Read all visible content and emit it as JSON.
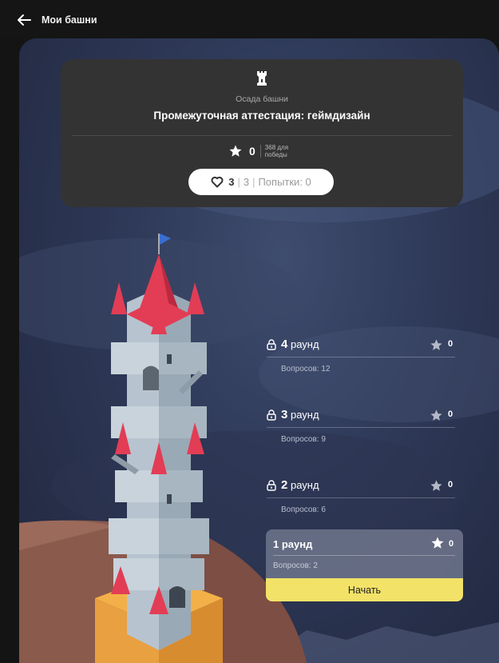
{
  "header": {
    "back_label": "Мои башни"
  },
  "tower_card": {
    "subtitle": "Осада башни",
    "title": "Промежуточная аттестация: геймдизайн",
    "score": "0",
    "goal_line1": "368 для",
    "goal_line2": "победы",
    "lives": "3",
    "lives_max": "3",
    "attempts_label": "Попытки: 0"
  },
  "rounds": [
    {
      "name_num": "4",
      "name_word": "раунд",
      "questions": "Вопросов: 12",
      "score": "0",
      "locked": true
    },
    {
      "name_num": "3",
      "name_word": "раунд",
      "questions": "Вопросов: 9",
      "score": "0",
      "locked": true
    },
    {
      "name_num": "2",
      "name_word": "раунд",
      "questions": "Вопросов: 6",
      "score": "0",
      "locked": true
    }
  ],
  "active_round": {
    "name": "1 раунд",
    "questions": "Вопросов: 2",
    "score": "0",
    "start_label": "Начать"
  },
  "colors": {
    "card_bg": "#333333",
    "accent_yellow": "#f3e268",
    "roof_red": "#e23d55",
    "tower_stone": "#c8d3dc"
  }
}
